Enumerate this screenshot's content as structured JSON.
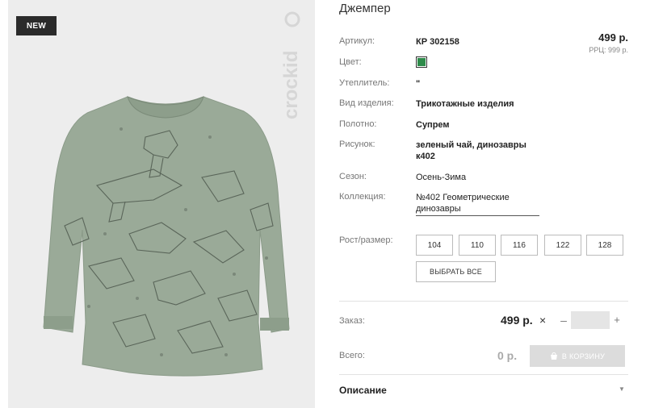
{
  "badge": "NEW",
  "brand_logo_text": "crockid",
  "product": {
    "title": "Джемпер",
    "price": "499 р.",
    "rrp": "РРЦ: 999 р."
  },
  "attributes": [
    {
      "label": "Артикул:",
      "value": "КР 302158"
    },
    {
      "label": "Цвет:",
      "value_color": "#2e8b4a"
    },
    {
      "label": "Утеплитель:",
      "value": "\""
    },
    {
      "label": "Вид изделия:",
      "value": "Трикотажные изделия"
    },
    {
      "label": "Полотно:",
      "value": "Супрем"
    },
    {
      "label": "Рисунок:",
      "value_line1": "зеленый чай, динозавры",
      "value_line2": "к402"
    },
    {
      "label": "Сезон:",
      "value": "Осень-Зима"
    },
    {
      "label": "Коллекция:",
      "value_line1": "№402 Геометрические",
      "value_line2": "динозавры"
    }
  ],
  "sizes": {
    "label": "Рост/размер:",
    "options": [
      "104",
      "110",
      "116",
      "122",
      "128"
    ],
    "select_all": "ВЫБРАТЬ ВСЕ"
  },
  "order": {
    "label": "Заказ:",
    "price": "499 р.",
    "multiply": "×",
    "minus": "–",
    "quantity": "",
    "plus": "+"
  },
  "total": {
    "label": "Всего:",
    "price": "0 р.",
    "cart_button": "В КОРЗИНУ"
  },
  "description": {
    "label": "Описание",
    "arrow": "▼"
  },
  "colors": {
    "swatch": "#2e8b4a",
    "garment": "#9aaa98",
    "badge_bg": "#2b2b2b"
  }
}
